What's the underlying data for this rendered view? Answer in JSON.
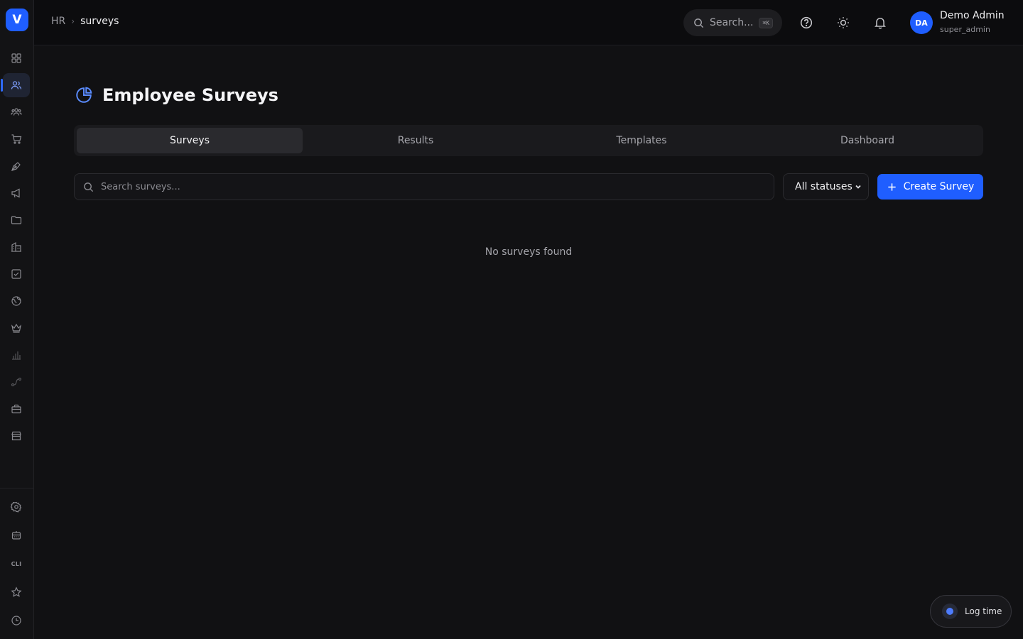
{
  "brand": {
    "logo_letter": "V",
    "accent": "#1f5eff"
  },
  "breadcrumb": {
    "root": "HR",
    "current": "surveys"
  },
  "topbar": {
    "search_label": "Search...",
    "search_shortcut": "⌘K",
    "user": {
      "initials": "DA",
      "name": "Demo Admin",
      "role": "super_admin"
    }
  },
  "sidebar": {
    "items": [
      {
        "icon": "dashboard-grid-icon"
      },
      {
        "icon": "users-icon",
        "active": true
      },
      {
        "icon": "team-icon"
      },
      {
        "icon": "cart-icon"
      },
      {
        "icon": "pen-icon"
      },
      {
        "icon": "megaphone-icon"
      },
      {
        "icon": "folder-icon"
      },
      {
        "icon": "building-icon"
      },
      {
        "icon": "checklist-icon"
      },
      {
        "icon": "globe-icon"
      },
      {
        "icon": "crown-icon"
      },
      {
        "icon": "bar-chart-icon"
      },
      {
        "icon": "route-icon"
      },
      {
        "icon": "briefcase-icon"
      },
      {
        "icon": "store-icon"
      }
    ],
    "bottom": {
      "cli_label": "CLI",
      "icons": [
        "settings-icon",
        "robot-icon",
        "cli-icon",
        "star-icon",
        "clock-icon"
      ]
    }
  },
  "page": {
    "title": "Employee Surveys",
    "tabs": [
      {
        "label": "Surveys",
        "active": true
      },
      {
        "label": "Results"
      },
      {
        "label": "Templates"
      },
      {
        "label": "Dashboard"
      }
    ],
    "search_placeholder": "Search surveys...",
    "status_filter": "All statuses",
    "create_label": "Create Survey",
    "empty_message": "No surveys found"
  },
  "log_time": {
    "label": "Log time"
  }
}
